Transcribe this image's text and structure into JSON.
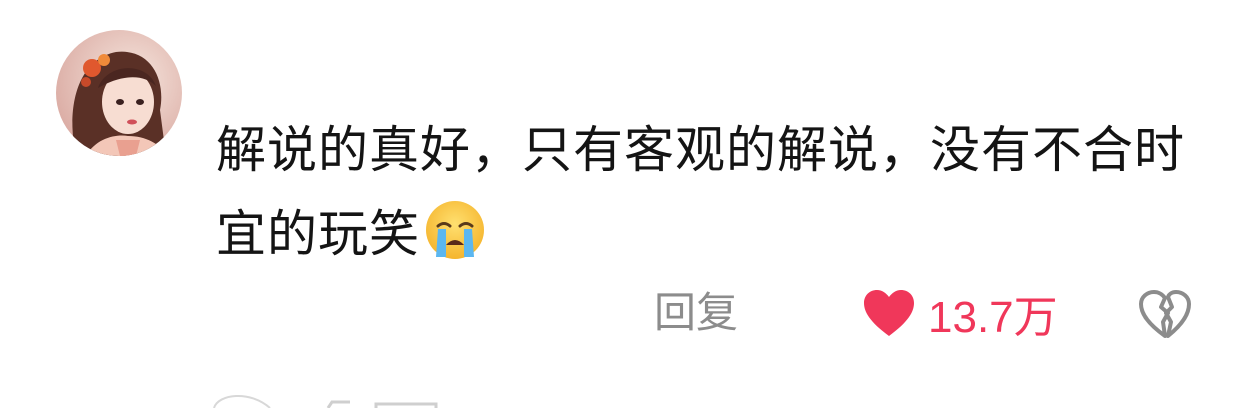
{
  "comment": {
    "text": "解说的真好，只有客观的解说，没有不合时宜的玩笑",
    "emoji": "loudly-crying-face"
  },
  "actions": {
    "reply_label": "回复",
    "like_count": "13.7万",
    "like_color": "#f0375a",
    "dislike_icon": "broken-heart-icon"
  },
  "colors": {
    "text": "#141414",
    "secondary": "#8c8c8c"
  }
}
